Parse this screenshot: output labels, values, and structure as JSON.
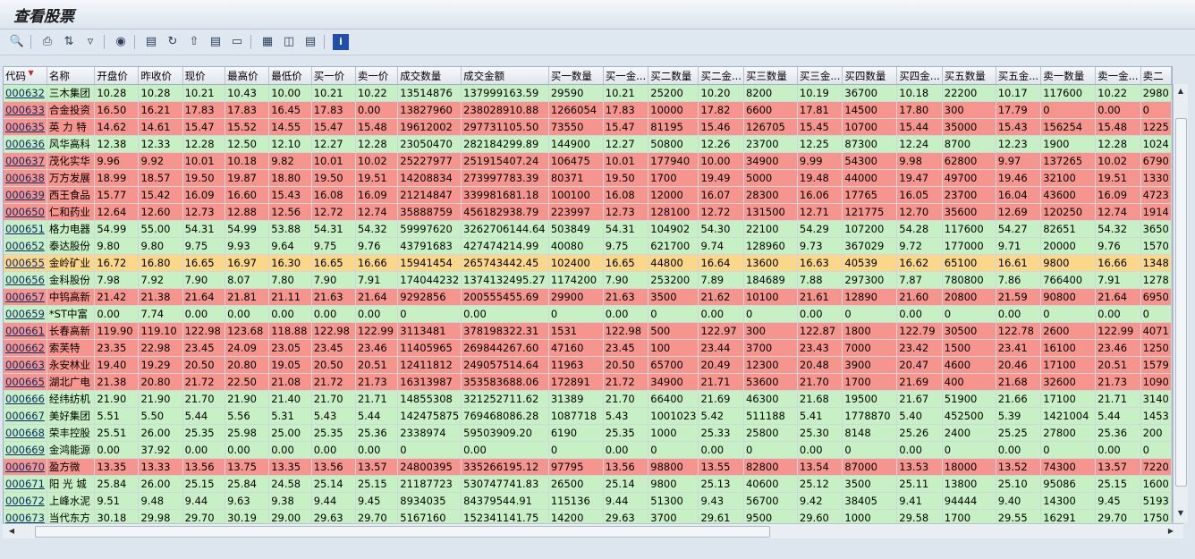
{
  "title": "查看股票",
  "toolbar": [
    "zoom-icon",
    "print-icon",
    "sort-icon",
    "filter-icon",
    "find-icon",
    "export-icon",
    "refresh-icon",
    "upload-icon",
    "layout-icon",
    "chart-icon",
    "grid-icon",
    "columns-icon",
    "rows-icon",
    "info-icon"
  ],
  "columns": [
    "代码",
    "名称",
    "开盘价",
    "昨收价",
    "现价",
    "最高价",
    "最低价",
    "买一价",
    "卖一价",
    "成交数量",
    "成交金额",
    "买一数量",
    "买一金...",
    "买二数量",
    "买二金...",
    "买三数量",
    "买三金...",
    "买四数量",
    "买四金...",
    "买五数量",
    "买五金...",
    "卖一数量",
    "卖一金...",
    "卖二"
  ],
  "rows": [
    {
      "s": "g",
      "c": [
        "000632",
        "三木集团",
        "10.28",
        "10.28",
        "10.21",
        "10.43",
        "10.00",
        "10.21",
        "10.22",
        "13514876",
        "137999163.59",
        "29590",
        "10.21",
        "25200",
        "10.20",
        "8200",
        "10.19",
        "36700",
        "10.18",
        "22200",
        "10.17",
        "117600",
        "10.22",
        "2980"
      ]
    },
    {
      "s": "r",
      "c": [
        "000633",
        "合金投资",
        "16.50",
        "16.21",
        "17.83",
        "17.83",
        "16.45",
        "17.83",
        "0.00",
        "13827960",
        "238028910.88",
        "1266054",
        "17.83",
        "10000",
        "17.82",
        "6600",
        "17.81",
        "14500",
        "17.80",
        "300",
        "17.79",
        "0",
        "0.00",
        "0"
      ]
    },
    {
      "s": "r",
      "c": [
        "000635",
        "英 力 特",
        "14.62",
        "14.61",
        "15.47",
        "15.52",
        "14.55",
        "15.47",
        "15.48",
        "19612002",
        "297731105.50",
        "73550",
        "15.47",
        "81195",
        "15.46",
        "126705",
        "15.45",
        "10700",
        "15.44",
        "35000",
        "15.43",
        "156254",
        "15.48",
        "1225"
      ]
    },
    {
      "s": "g",
      "c": [
        "000636",
        "风华高科",
        "12.38",
        "12.33",
        "12.28",
        "12.50",
        "12.10",
        "12.27",
        "12.28",
        "23050470",
        "282184299.89",
        "144900",
        "12.27",
        "50800",
        "12.26",
        "23700",
        "12.25",
        "87300",
        "12.24",
        "8700",
        "12.23",
        "1900",
        "12.28",
        "1024"
      ]
    },
    {
      "s": "r",
      "c": [
        "000637",
        "茂化实华",
        "9.96",
        "9.92",
        "10.01",
        "10.18",
        "9.82",
        "10.01",
        "10.02",
        "25227977",
        "251915407.24",
        "106475",
        "10.01",
        "177940",
        "10.00",
        "34900",
        "9.99",
        "54300",
        "9.98",
        "62800",
        "9.97",
        "137265",
        "10.02",
        "6790"
      ]
    },
    {
      "s": "r",
      "c": [
        "000638",
        "万方发展",
        "18.99",
        "18.57",
        "19.50",
        "19.87",
        "18.80",
        "19.50",
        "19.51",
        "14208834",
        "273997783.39",
        "80371",
        "19.50",
        "1700",
        "19.49",
        "5000",
        "19.48",
        "44000",
        "19.47",
        "49700",
        "19.46",
        "32100",
        "19.51",
        "1330"
      ]
    },
    {
      "s": "r",
      "c": [
        "000639",
        "西王食品",
        "15.77",
        "15.42",
        "16.09",
        "16.60",
        "15.43",
        "16.08",
        "16.09",
        "21214847",
        "339981681.18",
        "100100",
        "16.08",
        "12000",
        "16.07",
        "28300",
        "16.06",
        "17765",
        "16.05",
        "23700",
        "16.04",
        "43600",
        "16.09",
        "4723"
      ]
    },
    {
      "s": "r",
      "c": [
        "000650",
        "仁和药业",
        "12.64",
        "12.60",
        "12.73",
        "12.88",
        "12.56",
        "12.72",
        "12.74",
        "35888759",
        "456182938.79",
        "223997",
        "12.73",
        "128100",
        "12.72",
        "131500",
        "12.71",
        "121775",
        "12.70",
        "35600",
        "12.69",
        "120250",
        "12.74",
        "1914"
      ]
    },
    {
      "s": "g",
      "c": [
        "000651",
        "格力电器",
        "54.99",
        "55.00",
        "54.31",
        "54.99",
        "53.88",
        "54.31",
        "54.32",
        "59997620",
        "3262706144.64",
        "503849",
        "54.31",
        "104902",
        "54.30",
        "22100",
        "54.29",
        "107200",
        "54.28",
        "117600",
        "54.27",
        "82651",
        "54.32",
        "3650"
      ]
    },
    {
      "s": "g",
      "c": [
        "000652",
        "泰达股份",
        "9.80",
        "9.80",
        "9.75",
        "9.93",
        "9.64",
        "9.75",
        "9.76",
        "43791683",
        "427474214.99",
        "40080",
        "9.75",
        "621700",
        "9.74",
        "128960",
        "9.73",
        "367029",
        "9.72",
        "177000",
        "9.71",
        "20000",
        "9.76",
        "1570"
      ]
    },
    {
      "s": "y",
      "c": [
        "000655",
        "金岭矿业",
        "16.72",
        "16.80",
        "16.65",
        "16.97",
        "16.30",
        "16.65",
        "16.66",
        "15941454",
        "265743442.45",
        "102400",
        "16.65",
        "44800",
        "16.64",
        "13600",
        "16.63",
        "40539",
        "16.62",
        "65100",
        "16.61",
        "9800",
        "16.66",
        "1348"
      ]
    },
    {
      "s": "g",
      "c": [
        "000656",
        "金科股份",
        "7.98",
        "7.92",
        "7.90",
        "8.07",
        "7.80",
        "7.90",
        "7.91",
        "174044232",
        "1374132495.27",
        "1174200",
        "7.90",
        "253200",
        "7.89",
        "184689",
        "7.88",
        "297300",
        "7.87",
        "780800",
        "7.86",
        "766400",
        "7.91",
        "1278"
      ]
    },
    {
      "s": "r",
      "c": [
        "000657",
        "中钨高新",
        "21.42",
        "21.38",
        "21.64",
        "21.81",
        "21.11",
        "21.63",
        "21.64",
        "9292856",
        "200555455.69",
        "29900",
        "21.63",
        "3500",
        "21.62",
        "10100",
        "21.61",
        "12890",
        "21.60",
        "20800",
        "21.59",
        "90800",
        "21.64",
        "6950"
      ]
    },
    {
      "s": "g",
      "c": [
        "000659",
        "*ST中富",
        "0.00",
        "7.74",
        "0.00",
        "0.00",
        "0.00",
        "0.00",
        "0.00",
        "0",
        "0.00",
        "0",
        "0.00",
        "0",
        "0.00",
        "0",
        "0.00",
        "0",
        "0.00",
        "0",
        "0.00",
        "0",
        "0.00",
        "0"
      ]
    },
    {
      "s": "r",
      "c": [
        "000661",
        "长春高新",
        "119.90",
        "119.10",
        "122.98",
        "123.68",
        "118.88",
        "122.98",
        "122.99",
        "3113481",
        "378198322.31",
        "1531",
        "122.98",
        "500",
        "122.97",
        "300",
        "122.87",
        "1800",
        "122.79",
        "30500",
        "122.78",
        "2600",
        "122.99",
        "4071"
      ]
    },
    {
      "s": "r",
      "c": [
        "000662",
        "索芙特",
        "23.35",
        "22.98",
        "23.45",
        "24.09",
        "23.05",
        "23.45",
        "23.46",
        "11405965",
        "269844267.60",
        "47160",
        "23.45",
        "100",
        "23.44",
        "3700",
        "23.43",
        "7000",
        "23.42",
        "1500",
        "23.41",
        "16100",
        "23.46",
        "1250"
      ]
    },
    {
      "s": "r",
      "c": [
        "000663",
        "永安林业",
        "19.40",
        "19.29",
        "20.50",
        "20.80",
        "19.05",
        "20.50",
        "20.51",
        "12411812",
        "249057514.64",
        "11963",
        "20.50",
        "65700",
        "20.49",
        "12300",
        "20.48",
        "3900",
        "20.47",
        "4600",
        "20.46",
        "17100",
        "20.51",
        "1579"
      ]
    },
    {
      "s": "r",
      "c": [
        "000665",
        "湖北广电",
        "21.38",
        "20.80",
        "21.72",
        "22.50",
        "21.08",
        "21.72",
        "21.73",
        "16313987",
        "353583688.06",
        "172891",
        "21.72",
        "34900",
        "21.71",
        "53600",
        "21.70",
        "1700",
        "21.69",
        "400",
        "21.68",
        "32600",
        "21.73",
        "1090"
      ]
    },
    {
      "s": "g",
      "c": [
        "000666",
        "经纬纺机",
        "21.90",
        "21.90",
        "21.70",
        "21.90",
        "21.40",
        "21.70",
        "21.71",
        "14855308",
        "321252711.62",
        "31389",
        "21.70",
        "66400",
        "21.69",
        "46300",
        "21.68",
        "19500",
        "21.67",
        "51900",
        "21.66",
        "17100",
        "21.71",
        "3140"
      ]
    },
    {
      "s": "g",
      "c": [
        "000667",
        "美好集团",
        "5.51",
        "5.50",
        "5.44",
        "5.56",
        "5.31",
        "5.43",
        "5.44",
        "142475875",
        "769468086.28",
        "1087718",
        "5.43",
        "1001023",
        "5.42",
        "511188",
        "5.41",
        "1778870",
        "5.40",
        "452500",
        "5.39",
        "1421004",
        "5.44",
        "1453"
      ]
    },
    {
      "s": "g",
      "c": [
        "000668",
        "荣丰控股",
        "25.51",
        "26.00",
        "25.35",
        "25.98",
        "25.00",
        "25.35",
        "25.36",
        "2338974",
        "59503909.20",
        "6190",
        "25.35",
        "1000",
        "25.33",
        "25800",
        "25.30",
        "8148",
        "25.26",
        "2400",
        "25.25",
        "27800",
        "25.36",
        "200"
      ]
    },
    {
      "s": "g",
      "c": [
        "000669",
        "金鸿能源",
        "0.00",
        "37.92",
        "0.00",
        "0.00",
        "0.00",
        "0.00",
        "0.00",
        "0",
        "0.00",
        "0",
        "0.00",
        "0",
        "0.00",
        "0",
        "0.00",
        "0",
        "0.00",
        "0",
        "0.00",
        "0",
        "0.00",
        "0"
      ]
    },
    {
      "s": "r",
      "c": [
        "000670",
        "盈方微",
        "13.35",
        "13.33",
        "13.56",
        "13.75",
        "13.35",
        "13.56",
        "13.57",
        "24800395",
        "335266195.12",
        "97795",
        "13.56",
        "98800",
        "13.55",
        "82800",
        "13.54",
        "87000",
        "13.53",
        "18000",
        "13.52",
        "74300",
        "13.57",
        "7220"
      ]
    },
    {
      "s": "g",
      "c": [
        "000671",
        "阳 光 城",
        "25.84",
        "26.00",
        "25.15",
        "25.84",
        "24.58",
        "25.14",
        "25.15",
        "21187723",
        "530747741.83",
        "26500",
        "25.14",
        "9800",
        "25.13",
        "40600",
        "25.12",
        "3500",
        "25.11",
        "13800",
        "25.10",
        "95086",
        "25.15",
        "1600"
      ]
    },
    {
      "s": "g",
      "c": [
        "000672",
        "上峰水泥",
        "9.51",
        "9.48",
        "9.44",
        "9.63",
        "9.38",
        "9.44",
        "9.45",
        "8934035",
        "84379544.91",
        "115136",
        "9.44",
        "51300",
        "9.43",
        "56700",
        "9.42",
        "38405",
        "9.41",
        "94444",
        "9.40",
        "14300",
        "9.45",
        "5193"
      ]
    },
    {
      "s": "g",
      "c": [
        "000673",
        "当代东方",
        "30.18",
        "29.98",
        "29.70",
        "30.19",
        "29.00",
        "29.63",
        "29.70",
        "5167160",
        "152341141.75",
        "14200",
        "29.63",
        "3700",
        "29.61",
        "9500",
        "29.60",
        "1000",
        "29.58",
        "1700",
        "29.55",
        "16291",
        "29.70",
        "1750"
      ]
    }
  ]
}
